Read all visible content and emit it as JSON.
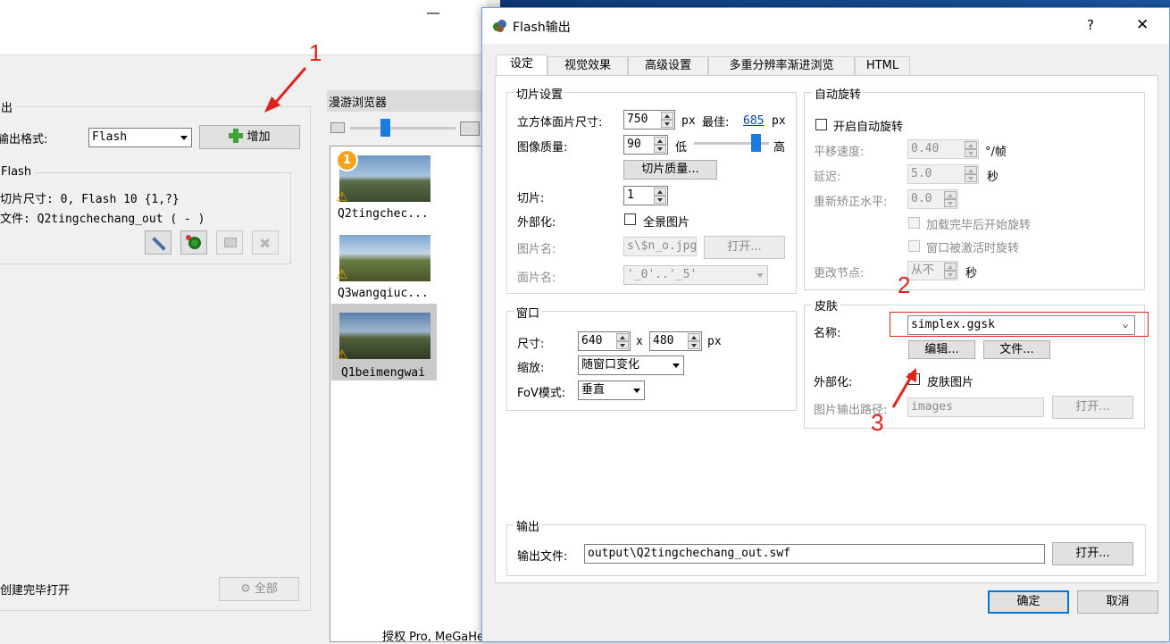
{
  "background_app": {
    "section_label": "出",
    "output_format_label": "输出格式:",
    "output_format_value": "Flash",
    "add_button": "增加",
    "flash_group_title": "Flash",
    "tile_size_line": "切片尺寸: 0, Flash 10 {1,?}",
    "file_line": "文件: Q2tingchechang_out ( - )",
    "open_after_create": "创建完毕打开",
    "all_button": "全部",
    "tour_browser_title": "漫游浏览器",
    "thumbnails": [
      {
        "label": "Q2tingchec...",
        "badge": "1"
      },
      {
        "label": "Q3wangqiuc..."
      },
      {
        "label": "Q1beimengwai"
      }
    ],
    "status_bar": "授权 Pro, MeGaHeRTZ :"
  },
  "dialog": {
    "title": "Flash输出",
    "help": "?",
    "close": "✕",
    "tabs": [
      "设定",
      "视觉效果",
      "高级设置",
      "多重分辨率渐进浏览",
      "HTML"
    ],
    "tile_settings": {
      "title": "切片设置",
      "cube_face_size_label": "立方体面片尺寸:",
      "cube_face_size_value": "750",
      "px": "px",
      "best_label": "最佳:",
      "best_value": "685",
      "px2": "px",
      "quality_label": "图像质量:",
      "quality_value": "90",
      "quality_low": "低",
      "quality_high": "高",
      "quality_slider_level": 0.88,
      "tile_quality_button": "切片质量...",
      "tiles_label": "切片:",
      "tiles_value": "1",
      "externalize_label": "外部化:",
      "pano_image_label": "全景图片",
      "image_name_label": "图片名:",
      "image_name_value": "s\\$n_o.jpg",
      "open_button": "打开...",
      "face_name_label": "面片名:",
      "face_name_value": "'_0'..'_5'"
    },
    "auto_rotate": {
      "title": "自动旋转",
      "enable_label": "开启自动旋转",
      "pan_speed_label": "平移速度:",
      "pan_speed_value": "0.40",
      "pan_speed_unit": "°/帧",
      "delay_label": "延迟:",
      "delay_value": "5.0",
      "delay_unit": "秒",
      "horizon_label": "重新矫正水平:",
      "horizon_value": "0.0",
      "start_after_load": "加载完毕后开始旋转",
      "rotate_when_active": "窗口被激活时旋转",
      "change_node_label": "更改节点:",
      "change_node_value": "从不",
      "change_node_unit": "秒"
    },
    "window": {
      "title": "窗口",
      "size_label": "尺寸:",
      "width": "640",
      "x": "x",
      "height": "480",
      "px": "px",
      "scale_label": "缩放:",
      "scale_value": "随窗口变化",
      "fov_label": "FoV模式:",
      "fov_value": "垂直"
    },
    "skin": {
      "title": "皮肤",
      "name_label": "名称:",
      "name_value": "simplex.ggsk",
      "edit_button": "编辑...",
      "file_button": "文件...",
      "externalize_label": "外部化:",
      "skin_image_label": "皮肤图片",
      "image_path_label": "图片输出路径:",
      "image_path_value": "images",
      "open_button": "打开..."
    },
    "output": {
      "title": "输出",
      "file_label": "输出文件:",
      "file_value": "output\\Q2tingchechang_out.swf",
      "open_button": "打开..."
    },
    "ok_button": "确定",
    "cancel_button": "取消"
  },
  "annotations": [
    "1",
    "2",
    "3"
  ],
  "colors": {
    "annotation": "#e0231a",
    "link": "#0645ad",
    "accent": "#0078d7"
  }
}
